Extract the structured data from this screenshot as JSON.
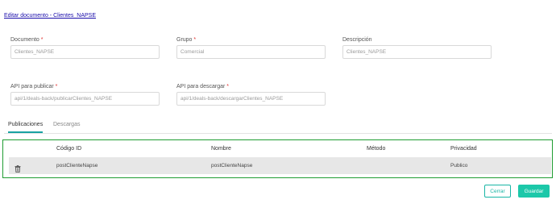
{
  "header": {
    "link": "Editar documento - Clientes_NAPSE"
  },
  "form": {
    "documento": {
      "label": "Documento",
      "required": "*",
      "value": "Clientes_NAPSE"
    },
    "grupo": {
      "label": "Grupo",
      "required": "*",
      "value": "Comercial"
    },
    "descripcion": {
      "label": "Descripción",
      "value": "Clientes_NAPSE"
    },
    "api_publicar": {
      "label": "API para publicar",
      "required": "*",
      "value": "api/1/deals-back/publicarClientes_NAPSE"
    },
    "api_descargar": {
      "label": "API para descargar",
      "required": "*",
      "value": "api/1/deals-back/descargarClientes_NAPSE"
    }
  },
  "tabs": [
    {
      "label": "Publicaciones",
      "active": true
    },
    {
      "label": "Descargas",
      "active": false
    }
  ],
  "table": {
    "headers": [
      "Código ID",
      "Nombre",
      "Método",
      "Privacidad"
    ],
    "rows": [
      {
        "codigo": "postClienteNapse",
        "nombre": "postClienteNapse",
        "metodo": "",
        "privacidad": "Publico",
        "icon": "trash-icon"
      }
    ]
  },
  "buttons": {
    "cerrar": "Cerrar",
    "guardar": "Guardar"
  },
  "colors": {
    "accent": "#1cc8a9",
    "tab_underline": "#19a2a2",
    "frame": "#1f9c31",
    "required": "#e0302f"
  }
}
